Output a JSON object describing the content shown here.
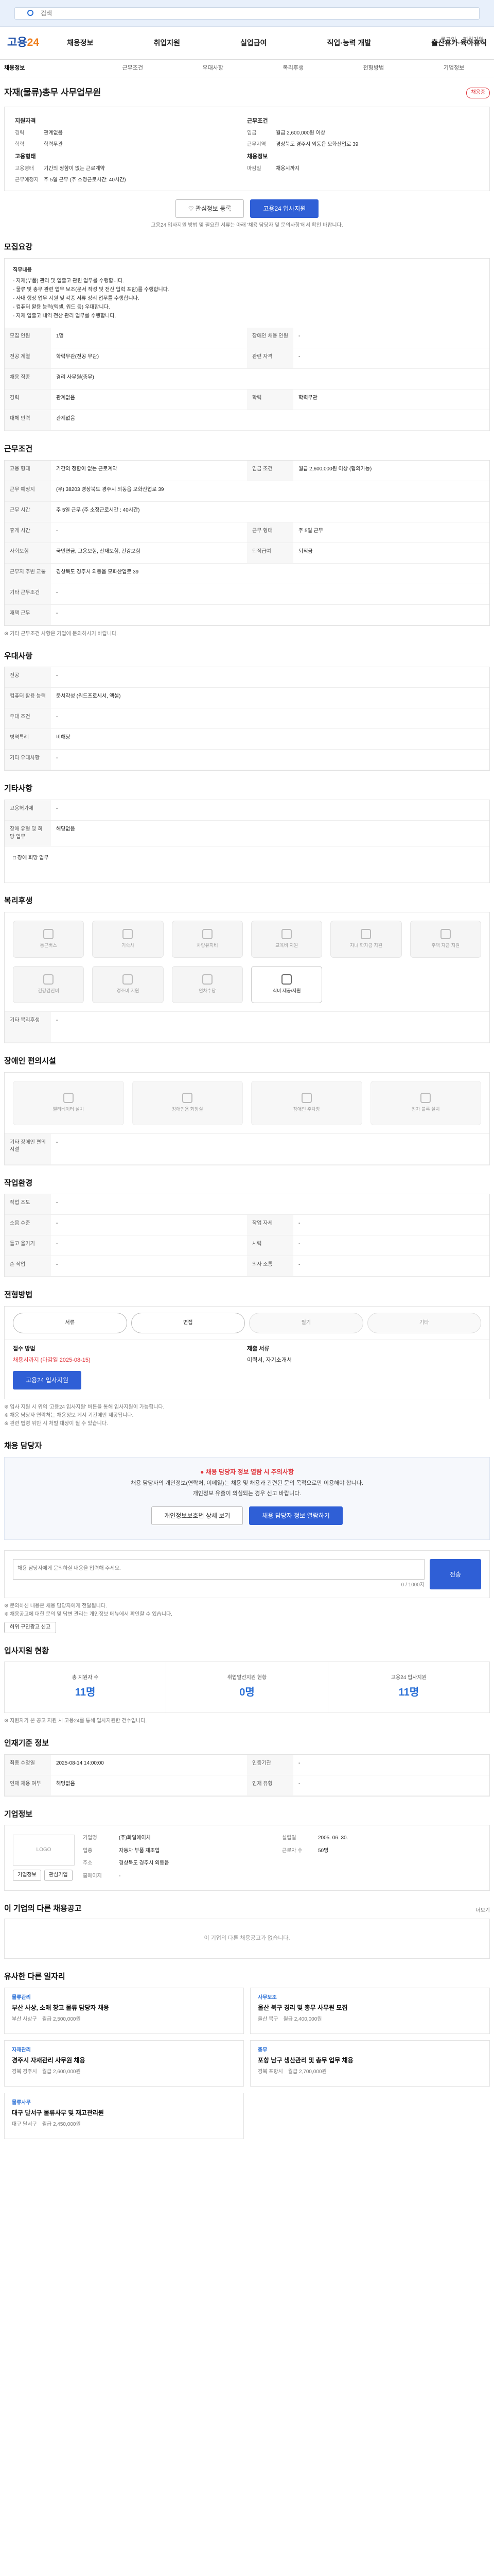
{
  "search": {
    "placeholder": "검색"
  },
  "top_links": [
    "로그인",
    "회원가입"
  ],
  "logo": {
    "main": "고용",
    "accent": "24"
  },
  "gnb": [
    "채용정보",
    "취업지원",
    "실업급여",
    "직업·능력 개발",
    "출산휴가·육아휴직"
  ],
  "subtabs": [
    "채용정보",
    "근무조건",
    "우대사항",
    "복리후생",
    "전형방법",
    "기업정보"
  ],
  "job": {
    "title": "자재(물류)총무 사무업무원",
    "status_badge": "채용중",
    "left": {
      "heading1": "지원자격",
      "rows1": [
        {
          "k": "경력",
          "v": "관계없음"
        },
        {
          "k": "학력",
          "v": "학력무관"
        }
      ],
      "heading2": "고용형태",
      "rows2": [
        {
          "k": "고용형태",
          "v": "기간의 정함이 없는 근로계약"
        },
        {
          "k": "근무예정지",
          "v": "주 5일 근무 (주 소정근로시간: 40시간)"
        }
      ]
    },
    "right": {
      "heading1": "근무조건",
      "rows1": [
        {
          "k": "임금",
          "v": "월급 2,600,000원 이상"
        },
        {
          "k": "근무지역",
          "v": "경상북도 경주시 외동읍 모화산업로 39"
        }
      ],
      "heading2": "채용정보",
      "rows2": [
        {
          "k": "마감일",
          "v": "채용시까지"
        }
      ]
    },
    "scrap_btn": "관심정보 등록",
    "apply_btn": "고용24 입사지원",
    "notice": "고용24 입사지원 방법 및 필요한 서류는 아래 '채용 담당자 및 문의사항'에서 확인 바랍니다."
  },
  "detail": {
    "heading": "모집요강",
    "desc_title": "직무내용",
    "desc_lines": [
      "- 자재(부품) 관리 및 입출고 관련 업무를 수행합니다.",
      "- 물류 및 총무 관련 업무 보조(문서 작성 및 전산 입력 포함)를 수행합니다.",
      "- 사내 행정 업무 지원 및 각종 서류 정리 업무를 수행합니다.",
      "- 컴퓨터 활용 능력(엑셀, 워드 등) 우대합니다.",
      "- 자재 입출고 내역 전산 관리 업무를 수행합니다."
    ],
    "rows": [
      {
        "k1": "모집 인원",
        "v1": "1명",
        "k2": "장애인 채용 인원",
        "v2": "-"
      },
      {
        "k1": "전공 계열",
        "v1": "학력무관(전공 무관)",
        "k2": "관련 자격",
        "v2": "-"
      },
      {
        "k1": "채용 직종",
        "v1": "경리 사무원(총무)",
        "k2": "",
        "v2": ""
      },
      {
        "k1": "경력",
        "v1": "관계없음",
        "k2": "학력",
        "v2": "학력무관"
      },
      {
        "k1": "대체 인력",
        "v1": "관계없음",
        "k2": "",
        "v2": ""
      }
    ]
  },
  "work": {
    "heading": "근무조건",
    "rows": [
      {
        "k1": "고용 형태",
        "v1": "기간의 정함이 없는 근로계약",
        "k2": "임금 조건",
        "v2": "월급 2,600,000원 이상 (협의가능)"
      },
      {
        "k1": "근무 예정지",
        "v1": "(우) 38203 경상북도 경주시 외동읍 모화산업로 39",
        "k2": "",
        "v2": ""
      },
      {
        "k1": "근무 시간",
        "v1": "주 5일 근무 (주 소정근로시간 : 40시간)",
        "k2": "",
        "v2": ""
      },
      {
        "k1": "휴게 시간",
        "v1": "-",
        "k2": "근무 형태",
        "v2": "주 5일 근무"
      },
      {
        "k1": "사회보험",
        "v1": "국민연금, 고용보험, 산재보험, 건강보험",
        "k2": "퇴직급여",
        "v2": "퇴직금"
      },
      {
        "k1": "근무지 주변 교통",
        "v1": "경상북도 경주시 외동읍 모화산업로 39",
        "k2": "",
        "v2": ""
      },
      {
        "k1": "기타 근무조건",
        "v1": "-",
        "k2": "",
        "v2": ""
      },
      {
        "k1": "재택 근무",
        "v1": "-",
        "k2": "",
        "v2": ""
      }
    ],
    "note": "※ 기타 근무조건 사항은 기업에 문의하시기 바랍니다."
  },
  "pref": {
    "heading": "우대사항",
    "rows": [
      {
        "k": "전공",
        "v": "-"
      },
      {
        "k": "컴퓨터 활용 능력",
        "v": "문서작성 (워드프로세서, 엑셀)"
      },
      {
        "k": "우대 조건",
        "v": "-"
      },
      {
        "k": "병역특례",
        "v": "비해당"
      },
      {
        "k": "기타 우대사항",
        "v": "-"
      }
    ]
  },
  "other": {
    "heading": "기타사항",
    "rows": [
      {
        "k": "고용허가제",
        "v": "-"
      },
      {
        "k": "장애 유형 및 희망 업무",
        "v": "해당없음"
      }
    ],
    "note": "□ 장애 희망 업무"
  },
  "welfare": {
    "heading": "복리후생",
    "icons": [
      "통근버스",
      "기숙사",
      "차량유지비",
      "교육비 지원",
      "자녀 학자금 지원",
      "주택 자금 지원",
      "건강검진비",
      "경조비 지원",
      "연차수당",
      "식비 제공/지원"
    ],
    "active_index": 9,
    "extra_label": "기타 복리후생",
    "extra_value": "-"
  },
  "disability": {
    "heading": "장애인 편의시설",
    "icons": [
      "엘리베이터 설치",
      "장애인용 화장실",
      "장애인 주차장",
      "점자 블록 설치"
    ],
    "extra_label": "기타 장애인 편의시설",
    "extra_value": "-"
  },
  "worksite": {
    "heading": "작업환경",
    "rows": [
      {
        "k1": "작업 조도",
        "v1": "-",
        "k2": "",
        "v2": ""
      },
      {
        "k1": "소음 수준",
        "v1": "-",
        "k2": "작업 자세",
        "v2": "-"
      },
      {
        "k1": "들고 옮기기",
        "v1": "-",
        "k2": "시력",
        "v2": "-"
      },
      {
        "k1": "손 작업",
        "v1": "-",
        "k2": "의사 소통",
        "v2": "-"
      }
    ]
  },
  "process": {
    "heading": "전형방법",
    "steps": [
      "서류",
      "면접",
      "필기",
      "기타"
    ],
    "active": [
      0,
      1
    ],
    "apply_method_k": "접수 방법",
    "apply_method_v": "채용시까지 (마감일 2025-08-15)",
    "docs_k": "제출 서류",
    "docs_v": "이력서, 자기소개서",
    "apply_btn": "고용24 입사지원",
    "notes": [
      "※ 입사 지원 시 위의 '고용24 입사지원' 버튼을 통해 입사지원이 가능합니다.",
      "※ 채용 담당자 연락처는 채용정보 게시 기간에만 제공됩니다.",
      "※ 관련 법령 위반 시 처벌 대상이 될 수 있습니다."
    ]
  },
  "contact": {
    "heading": "채용 담당자",
    "alert": "채용 담당자 정보 열람 시 주의사항",
    "lines": [
      "채용 담당자의 개인정보(연락처, 이메일)는 채용 및 채용과 관련된 문의 목적으로만 이용해야 합니다.",
      "개인정보 유출이 의심되는 경우 신고 바랍니다."
    ],
    "btn1": "개인정보보호법 상세 보기",
    "btn2": "채용 담당자 정보 열람하기",
    "inq_placeholder": "채용 담당자에게 문의하실 내용을 입력해 주세요.",
    "inq_count": "0 / 1000자",
    "send_btn": "전송",
    "notes": [
      "※ 문의하신 내용은 채용 담당자에게 전달됩니다.",
      "※ 채용공고에 대한 문의 및 답변 관리는 개인정보 메뉴에서 확인할 수 있습니다."
    ],
    "report_btn": "허위 구인광고 신고"
  },
  "stats": {
    "heading": "입사지원 현황",
    "items": [
      {
        "label": "총 지원자 수",
        "value": "11명"
      },
      {
        "label": "취업알선지원 현황",
        "value": "0명"
      },
      {
        "label": "고용24 입사지원",
        "value": "11명"
      }
    ],
    "note": "※ 지원자가 본 공고 지원 시 고용24를 통해 입사지원한 건수입니다."
  },
  "recruit_info": {
    "heading": "인재기준 정보",
    "rows": [
      {
        "k1": "최종 수정일",
        "v1": "2025-08-14 14:00:00",
        "k2": "인증기관",
        "v2": "-"
      },
      {
        "k1": "인재 채용 여부",
        "v1": "해당없음",
        "k2": "인재 유형",
        "v2": "-"
      }
    ]
  },
  "company": {
    "heading": "기업정보",
    "logo_placeholder": "LOGO",
    "rows": [
      {
        "k1": "기업명",
        "v1": "(주)화일에이치",
        "k2": "설립일",
        "v2": "2005. 06. 30."
      },
      {
        "k1": "업종",
        "v1": "자동차 부품 제조업",
        "k2": "근로자 수",
        "v2": "50명"
      },
      {
        "k1": "주소",
        "v1": "경상북도 경주시 외동읍",
        "k2": "",
        "v2": ""
      },
      {
        "k1": "홈페이지",
        "v1": "-",
        "k2": "",
        "v2": ""
      }
    ],
    "btn1": "기업정보",
    "btn2": "관심기업"
  },
  "same_company": {
    "heading": "이 기업의 다른 채용공고",
    "empty": "이 기업의 다른 채용공고가 없습니다.",
    "more": "더보기"
  },
  "similar": {
    "heading": "유사한 다른 일자리",
    "items": [
      {
        "cat": "물류관리",
        "title": "부산 사상, 소매 창고 물류 담당자 채용",
        "loc": "부산 사상구",
        "pay": "월급 2,500,000원"
      },
      {
        "cat": "사무보조",
        "title": "울산 북구 경리 및 총무 사무원 모집",
        "loc": "울산 북구",
        "pay": "월급 2,400,000원"
      },
      {
        "cat": "자재관리",
        "title": "경주시 자재관리 사무원 채용",
        "loc": "경북 경주시",
        "pay": "월급 2,600,000원"
      },
      {
        "cat": "총무",
        "title": "포항 남구 생산관리 및 총무 업무 채용",
        "loc": "경북 포항시",
        "pay": "월급 2,700,000원"
      },
      {
        "cat": "물류사무",
        "title": "대구 달서구 물류사무 및 재고관리원",
        "loc": "대구 달서구",
        "pay": "월급 2,450,000원"
      }
    ]
  }
}
